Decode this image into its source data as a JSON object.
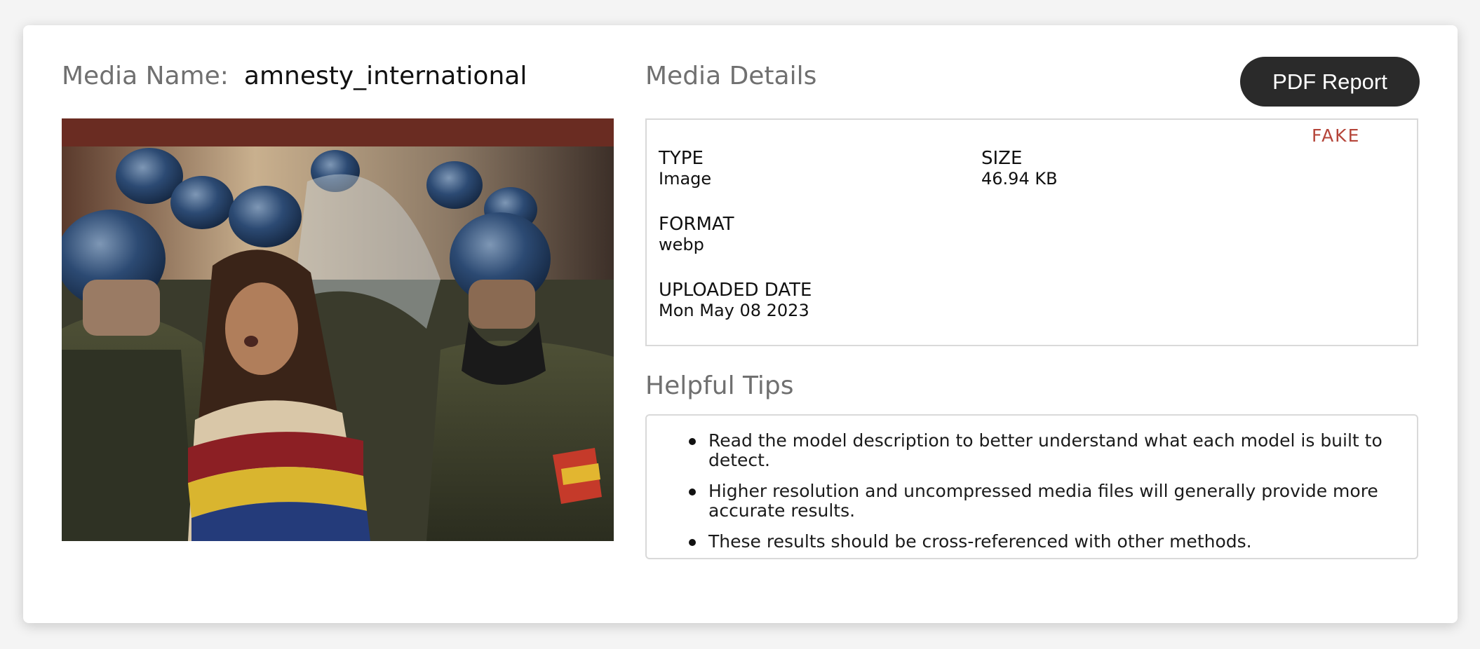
{
  "media": {
    "name_label": "Media Name:",
    "name_value": "amnesty_international",
    "image_alt": "Protester detained by riot police"
  },
  "details": {
    "title": "Media Details",
    "verdict": "FAKE",
    "verdict_color": "#b5453a",
    "fields": [
      {
        "label": "TYPE",
        "value": "Image"
      },
      {
        "label": "SIZE",
        "value": "46.94 KB"
      },
      {
        "label": "FORMAT",
        "value": "webp"
      },
      {
        "label": "UPLOADED DATE",
        "value": "Mon May 08 2023"
      }
    ]
  },
  "toolbar": {
    "pdf_report_label": "PDF Report"
  },
  "tips": {
    "title": "Helpful Tips",
    "items": [
      "Read the model description to better understand what each model is built to detect.",
      "Higher resolution and uncompressed media files will generally provide more accurate results.",
      "These results should be cross-referenced with other methods."
    ]
  }
}
